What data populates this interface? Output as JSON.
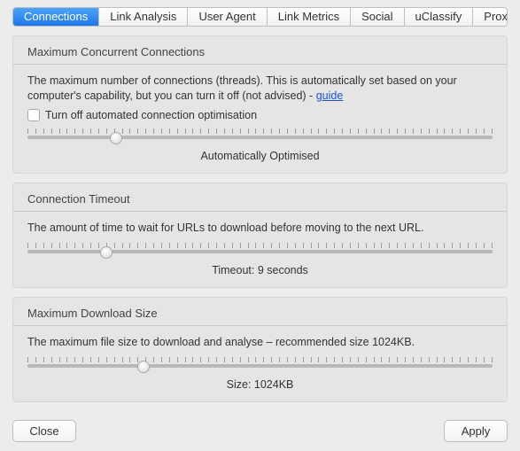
{
  "tabs": [
    {
      "label": "Connections",
      "active": true
    },
    {
      "label": "Link Analysis"
    },
    {
      "label": "User Agent"
    },
    {
      "label": "Link Metrics"
    },
    {
      "label": "Social"
    },
    {
      "label": "uClassify"
    },
    {
      "label": "Proxies"
    }
  ],
  "panels": {
    "conn": {
      "title": "Maximum Concurrent Connections",
      "desc_a": "The maximum number of connections (threads). This is automatically set based on your computer's capability, but you can turn it off (not advised) - ",
      "guide": "guide",
      "checkbox_label": "Turn off automated connection optimisation",
      "slider_pos_pct": 19,
      "caption": "Automatically Optimised"
    },
    "timeout": {
      "title": "Connection Timeout",
      "desc": "The amount of time to wait for URLs to download before moving to the next URL.",
      "slider_pos_pct": 17,
      "caption": "Timeout: 9 seconds"
    },
    "size": {
      "title": "Maximum Download Size",
      "desc": "The maximum file size to download and analyse – recommended size 1024KB.",
      "slider_pos_pct": 25,
      "caption": "Size: 1024KB"
    }
  },
  "footer": {
    "close": "Close",
    "apply": "Apply"
  }
}
